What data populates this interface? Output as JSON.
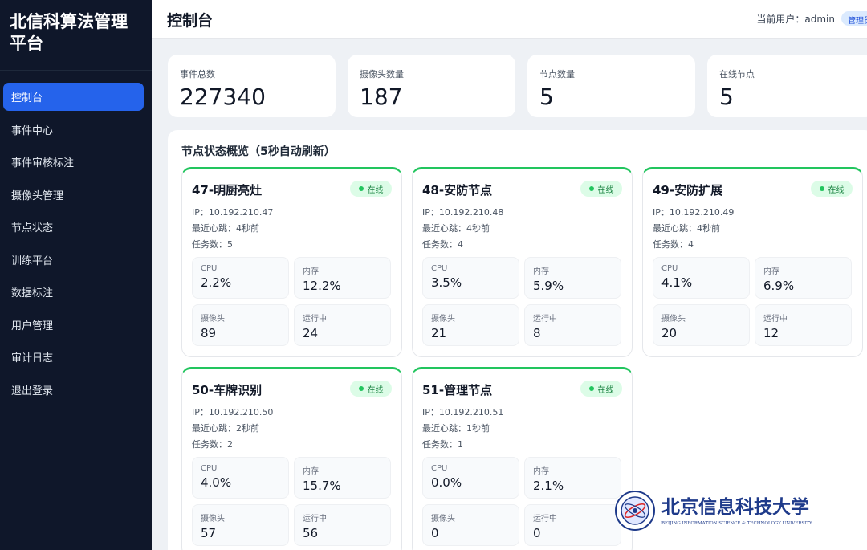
{
  "app": {
    "title": "北信科算法管理平台"
  },
  "sidebar": {
    "items": [
      {
        "label": "控制台"
      },
      {
        "label": "事件中心"
      },
      {
        "label": "事件审核标注"
      },
      {
        "label": "摄像头管理"
      },
      {
        "label": "节点状态"
      },
      {
        "label": "训练平台"
      },
      {
        "label": "数据标注"
      },
      {
        "label": "用户管理"
      },
      {
        "label": "审计日志"
      },
      {
        "label": "退出登录"
      }
    ]
  },
  "header": {
    "title": "控制台",
    "user_label": "当前用户：",
    "user_name": "admin",
    "role_badge": "管理员"
  },
  "stats": [
    {
      "label": "事件总数",
      "value": "227340"
    },
    {
      "label": "摄像头数量",
      "value": "187"
    },
    {
      "label": "节点数量",
      "value": "5"
    },
    {
      "label": "在线节点",
      "value": "5"
    }
  ],
  "panel": {
    "title": "节点状态概览（5秒自动刷新）",
    "metric_labels": {
      "cpu": "CPU",
      "mem": "内存",
      "cam": "摄像头",
      "running": "运行中"
    },
    "status_label": "在线",
    "status_color": "#22c55e",
    "nodes": [
      {
        "name": "47-明厨亮灶",
        "ip": "IP：10.192.210.47",
        "heartbeat": "最近心跳：4秒前",
        "tasks": "任务数：5",
        "cpu": "2.2%",
        "mem": "12.2%",
        "cam": "89",
        "running": "24"
      },
      {
        "name": "48-安防节点",
        "ip": "IP：10.192.210.48",
        "heartbeat": "最近心跳：4秒前",
        "tasks": "任务数：4",
        "cpu": "3.5%",
        "mem": "5.9%",
        "cam": "21",
        "running": "8"
      },
      {
        "name": "49-安防扩展",
        "ip": "IP：10.192.210.49",
        "heartbeat": "最近心跳：4秒前",
        "tasks": "任务数：4",
        "cpu": "4.1%",
        "mem": "6.9%",
        "cam": "20",
        "running": "12"
      },
      {
        "name": "50-车牌识别",
        "ip": "IP：10.192.210.50",
        "heartbeat": "最近心跳：2秒前",
        "tasks": "任务数：2",
        "cpu": "4.0%",
        "mem": "15.7%",
        "cam": "57",
        "running": "56"
      },
      {
        "name": "51-管理节点",
        "ip": "IP：10.192.210.51",
        "heartbeat": "最近心跳：1秒前",
        "tasks": "任务数：1",
        "cpu": "0.0%",
        "mem": "2.1%",
        "cam": "0",
        "running": "0"
      }
    ]
  },
  "logo": {
    "chinese": "北京信息科技大学",
    "english": "BEIJING INFORMATION SCIENCE & TECHNOLOGY UNIVERSITY",
    "color": "#1e3a8a"
  }
}
